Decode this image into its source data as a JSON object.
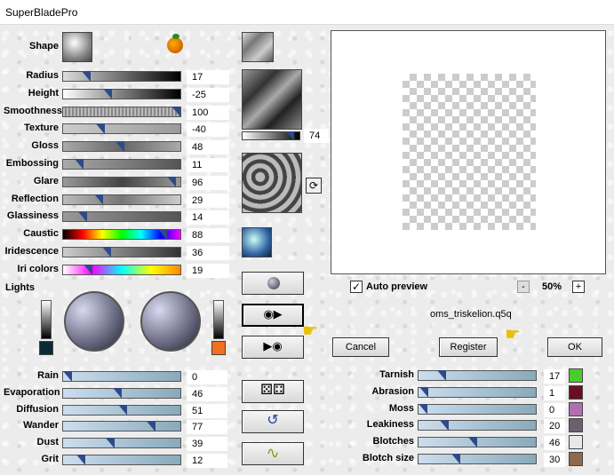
{
  "window": {
    "title": "SuperBladePro"
  },
  "shape": {
    "label": "Shape"
  },
  "sliders_left": [
    {
      "label": "Radius",
      "value": "17",
      "level": 0.17
    },
    {
      "label": "Height",
      "value": "-25",
      "level": 0.37
    },
    {
      "label": "Smoothness",
      "value": "100",
      "level": 1.0
    },
    {
      "label": "Texture",
      "value": "-40",
      "level": 0.3
    },
    {
      "label": "Gloss",
      "value": "48",
      "level": 0.48
    },
    {
      "label": "Embossing",
      "value": "11",
      "level": 0.11
    },
    {
      "label": "Glare",
      "value": "96",
      "level": 0.96
    },
    {
      "label": "Reflection",
      "value": "29",
      "level": 0.29
    },
    {
      "label": "Glassiness",
      "value": "14",
      "level": 0.14
    },
    {
      "label": "Caustic",
      "value": "88",
      "level": 0.88
    },
    {
      "label": "Iridescence",
      "value": "36",
      "level": 0.36
    },
    {
      "label": "Iri colors",
      "value": "19",
      "level": 0.19
    }
  ],
  "lights": {
    "label": "Lights"
  },
  "sliders_bottom_left": [
    {
      "label": "Rain",
      "value": "0",
      "level": 0.0
    },
    {
      "label": "Evaporation",
      "value": "46",
      "level": 0.46
    },
    {
      "label": "Diffusion",
      "value": "51",
      "level": 0.51
    },
    {
      "label": "Wander",
      "value": "77",
      "level": 0.77
    },
    {
      "label": "Dust",
      "value": "39",
      "level": 0.39
    },
    {
      "label": "Grit",
      "value": "12",
      "level": 0.12
    }
  ],
  "texture_scale": {
    "value": "74",
    "level": 0.74
  },
  "preview": {
    "auto_preview_label": "Auto preview",
    "zoom": "50%",
    "zoom_out": "-",
    "zoom_in": "+",
    "filename": "oms_triskelion.q5q"
  },
  "buttons": {
    "cancel": "Cancel",
    "register": "Register",
    "ok": "OK"
  },
  "sliders_right": [
    {
      "label": "Tarnish",
      "value": "17",
      "level": 0.17,
      "color": "#4ccc2c"
    },
    {
      "label": "Abrasion",
      "value": "1",
      "level": 0.01,
      "color": "#6a0f22"
    },
    {
      "label": "Moss",
      "value": "0",
      "level": 0.0,
      "color": "#b070b0"
    },
    {
      "label": "Leakiness",
      "value": "20",
      "level": 0.2,
      "color": "#6a6070"
    },
    {
      "label": "Blotches",
      "value": "46",
      "level": 0.46,
      "color": ""
    },
    {
      "label": "Blotch size",
      "value": "30",
      "level": 0.3,
      "color": "#8c6a50"
    }
  ],
  "icons": [
    "apple-icon",
    "rotate-icon",
    "dice-icon",
    "undo-icon",
    "wave-icon",
    "play-disk-icon",
    "disk-play-icon",
    "hand-pointer-icon"
  ]
}
